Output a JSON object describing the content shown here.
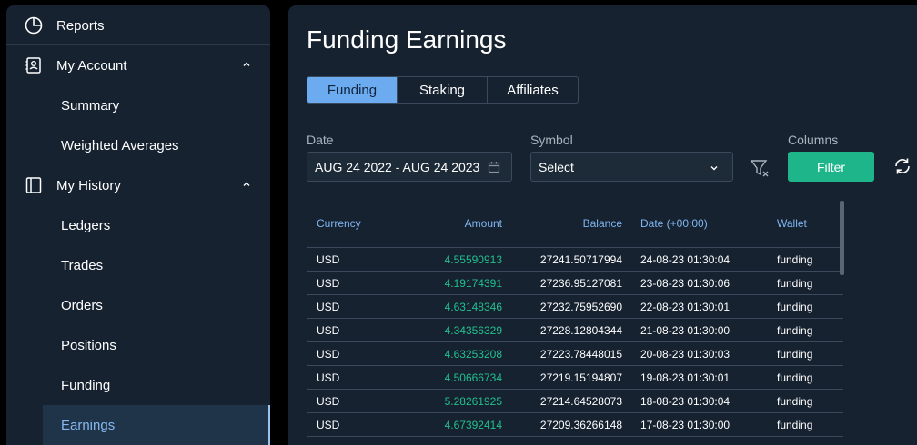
{
  "sidebar": {
    "reports_label": "Reports",
    "my_account_label": "My Account",
    "summary_label": "Summary",
    "weighted_averages_label": "Weighted Averages",
    "my_history_label": "My History",
    "ledgers_label": "Ledgers",
    "trades_label": "Trades",
    "orders_label": "Orders",
    "positions_label": "Positions",
    "funding_label": "Funding",
    "earnings_label": "Earnings"
  },
  "main": {
    "title": "Funding Earnings",
    "tabs": [
      {
        "label": "Funding",
        "active": true
      },
      {
        "label": "Staking",
        "active": false
      },
      {
        "label": "Affiliates",
        "active": false
      }
    ],
    "date_label": "Date",
    "date_value": "AUG 24 2022 - AUG 24 2023",
    "symbol_label": "Symbol",
    "symbol_value": "Select",
    "columns_label": "Columns",
    "filter_button": "Filter"
  },
  "table": {
    "headers": [
      "Currency",
      "Amount",
      "Balance",
      "Date (+00:00)",
      "Wallet"
    ],
    "rows": [
      {
        "currency": "USD",
        "amount": "4.55590913",
        "balance": "27241.50717994",
        "date": "24-08-23 01:30:04",
        "wallet": "funding"
      },
      {
        "currency": "USD",
        "amount": "4.19174391",
        "balance": "27236.95127081",
        "date": "23-08-23 01:30:06",
        "wallet": "funding"
      },
      {
        "currency": "USD",
        "amount": "4.63148346",
        "balance": "27232.75952690",
        "date": "22-08-23 01:30:01",
        "wallet": "funding"
      },
      {
        "currency": "USD",
        "amount": "4.34356329",
        "balance": "27228.12804344",
        "date": "21-08-23 01:30:00",
        "wallet": "funding"
      },
      {
        "currency": "USD",
        "amount": "4.63253208",
        "balance": "27223.78448015",
        "date": "20-08-23 01:30:03",
        "wallet": "funding"
      },
      {
        "currency": "USD",
        "amount": "4.50666734",
        "balance": "27219.15194807",
        "date": "19-08-23 01:30:01",
        "wallet": "funding"
      },
      {
        "currency": "USD",
        "amount": "5.28261925",
        "balance": "27214.64528073",
        "date": "18-08-23 01:30:04",
        "wallet": "funding"
      },
      {
        "currency": "USD",
        "amount": "4.67392414",
        "balance": "27209.36266148",
        "date": "17-08-23 01:30:00",
        "wallet": "funding"
      }
    ]
  },
  "colors": {
    "accent": "#6cabf0",
    "positive": "#21c08e",
    "filter_button": "#1fb58a",
    "panel": "#172230"
  },
  "icons": [
    "pie-chart-icon",
    "contact-card-icon",
    "book-icon",
    "chevron-up-icon",
    "calendar-icon",
    "chevron-down-icon",
    "filter-clear-icon",
    "refresh-icon"
  ]
}
